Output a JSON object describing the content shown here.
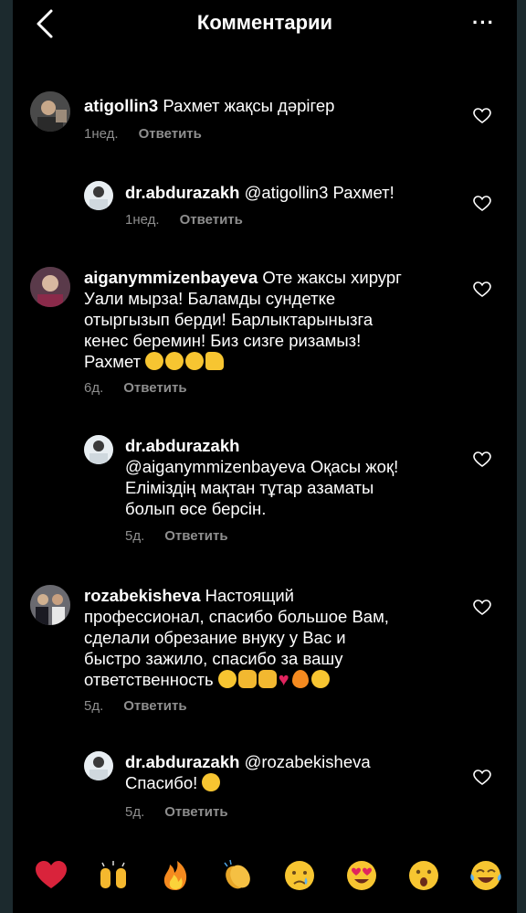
{
  "header": {
    "title": "Комментарии",
    "more_label": "···"
  },
  "comments": [
    {
      "username": "atigollin3",
      "text": " Рахмет жақсы дәрігер",
      "time": "1нед.",
      "reply": "Ответить"
    },
    {
      "username": "dr.abdurazakh",
      "text": " @atigollin3 Рахмет!",
      "time": "1нед.",
      "reply": "Ответить"
    },
    {
      "username": "aiganymmizenbayeva",
      "text_lines": [
        " Оте жаксы хирург",
        "Уали мырза! Баламды сундетке",
        "отыргызып берди! Барлыктарынызга",
        "кенес беремин! Биз сизге ризамыз!",
        "Рахмет "
      ],
      "time": "6д.",
      "reply": "Ответить"
    },
    {
      "username": "dr.abdurazakh",
      "text_lines": [
        "@aiganymmizenbayeva Оқасы жоқ!",
        "Еліміздің мақтан тұтар азаматы",
        "болып өсе берсін."
      ],
      "time": "5д.",
      "reply": "Ответить"
    },
    {
      "username": "rozabekisheva",
      "text_lines": [
        " Настоящий",
        "профессионал,  спасибо большое  Вам,",
        "сделали обрезание внуку  у Вас и",
        "быстро зажило,  спасибо за вашу",
        "ответственность "
      ],
      "time": "5д.",
      "reply": "Ответить"
    },
    {
      "username": "dr.abdurazakh",
      "text_lines": [
        " @rozabekisheva",
        "Спасибо! "
      ],
      "time": "5д.",
      "reply": "Ответить"
    }
  ],
  "reactions": [
    "red-heart",
    "raising-hands",
    "fire",
    "clapping-hands",
    "crying-face",
    "heart-eyes",
    "astonished-face",
    "tears-of-joy"
  ],
  "colors": {
    "background": "#000000",
    "secondary_text": "#8e8e8e",
    "frame": "#1c2a2e"
  }
}
